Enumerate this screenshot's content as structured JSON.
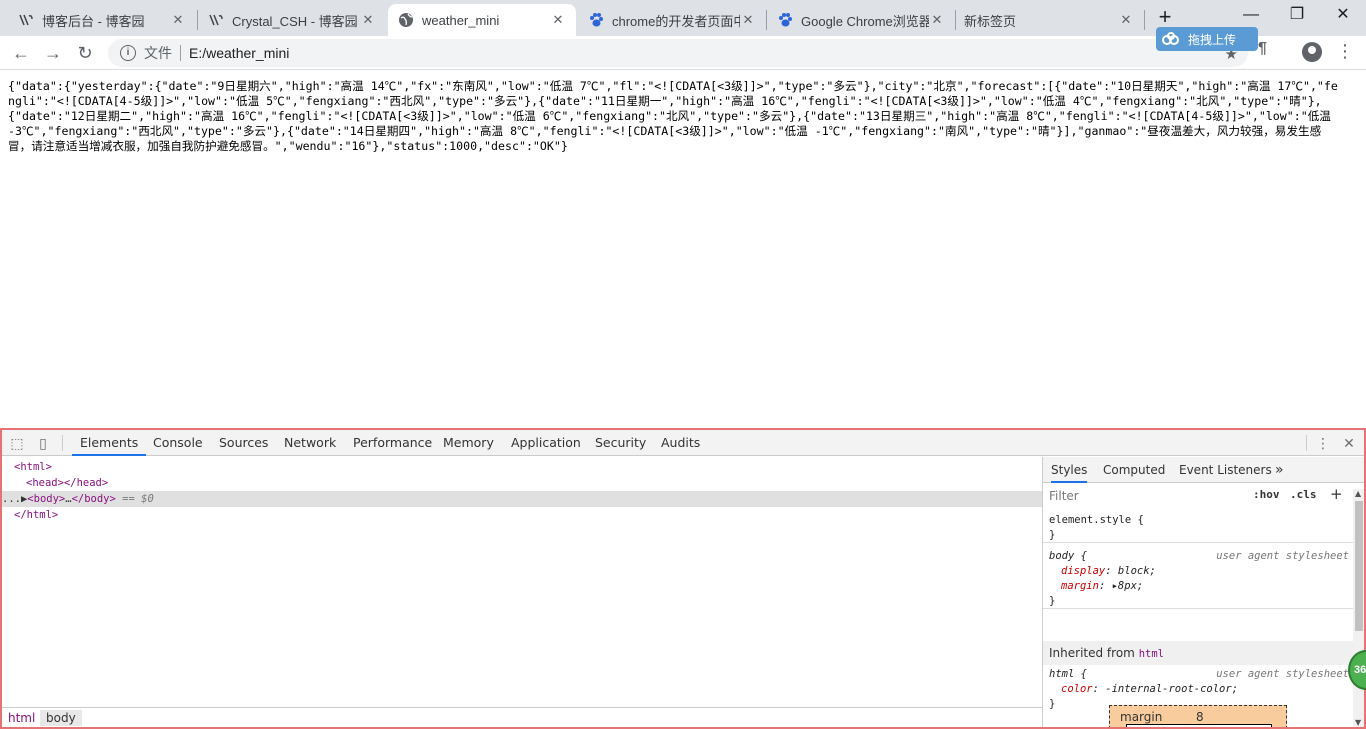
{
  "browser": {
    "tabs": [
      {
        "title": "博客后台 - 博客园",
        "icon": "cnblogs-icon"
      },
      {
        "title": "Crystal_CSH - 博客园",
        "icon": "cnblogs-icon"
      },
      {
        "title": "weather_mini",
        "icon": "globe-icon"
      },
      {
        "title": "chrome的开发者页面中",
        "icon": "baidu-paw-icon"
      },
      {
        "title": "Google Chrome浏览器",
        "icon": "baidu-paw-icon"
      },
      {
        "title": "新标签页",
        "icon": ""
      }
    ],
    "active_tab_index": 2,
    "address": {
      "security_label": "文件",
      "url": "E:/weather_mini"
    },
    "upload_button_label": "拖拽上传"
  },
  "page": {
    "body_text": "{\"data\":{\"yesterday\":{\"date\":\"9日星期六\",\"high\":\"高温 14℃\",\"fx\":\"东南风\",\"low\":\"低温 7℃\",\"fl\":\"<![CDATA[<3级]]>\",\"type\":\"多云\"},\"city\":\"北京\",\"forecast\":[{\"date\":\"10日星期天\",\"high\":\"高温 17℃\",\"fengli\":\"<![CDATA[4-5级]]>\",\"low\":\"低温 5℃\",\"fengxiang\":\"西北风\",\"type\":\"多云\"},{\"date\":\"11日星期一\",\"high\":\"高温 16℃\",\"fengli\":\"<![CDATA[<3级]]>\",\"low\":\"低温 4℃\",\"fengxiang\":\"北风\",\"type\":\"晴\"},{\"date\":\"12日星期二\",\"high\":\"高温 16℃\",\"fengli\":\"<![CDATA[<3级]]>\",\"low\":\"低温 6℃\",\"fengxiang\":\"北风\",\"type\":\"多云\"},{\"date\":\"13日星期三\",\"high\":\"高温 8℃\",\"fengli\":\"<![CDATA[4-5级]]>\",\"low\":\"低温 -3℃\",\"fengxiang\":\"西北风\",\"type\":\"多云\"},{\"date\":\"14日星期四\",\"high\":\"高温 8℃\",\"fengli\":\"<![CDATA[<3级]]>\",\"low\":\"低温 -1℃\",\"fengxiang\":\"南风\",\"type\":\"晴\"}],\"ganmao\":\"昼夜温差大，风力较强，易发生感冒，请注意适当增减衣服，加强自我防护避免感冒。\",\"wendu\":\"16\"},\"status\":1000,\"desc\":\"OK\"}"
  },
  "devtools": {
    "tabs": [
      "Elements",
      "Console",
      "Sources",
      "Network",
      "Performance",
      "Memory",
      "Application",
      "Security",
      "Audits"
    ],
    "active_tab": "Elements",
    "dom_lines": {
      "html_open": "<html>",
      "head": "<head></head>",
      "body_open": "<body>",
      "body_ellipsis": "…",
      "body_close": "</body>",
      "body_eq": "== $0",
      "html_close": "</html>",
      "selected_dots": "..."
    },
    "breadcrumbs": [
      "html",
      "body"
    ],
    "styles_tabs": [
      "Styles",
      "Computed",
      "Event Listeners"
    ],
    "styles_more": "»",
    "filter_placeholder": "Filter",
    "hov_label": ":hov",
    "cls_label": ".cls",
    "add_rule_label": "+",
    "rules": {
      "element_style": "element.style {",
      "close": "}",
      "body_selector": "body {",
      "body_source": "user agent stylesheet",
      "body_display_prop": "display",
      "body_display_val": "block;",
      "body_margin_prop": "margin",
      "body_margin_val": "8px;",
      "inherited_label": "Inherited from",
      "inherited_tag": "html",
      "html_selector": "html {",
      "html_source": "user agent stylesheet",
      "html_color_prop": "color",
      "html_color_val": "-internal-root-color;"
    },
    "box_model": {
      "label": "margin",
      "value": "8"
    }
  },
  "overlay_badge": "36"
}
